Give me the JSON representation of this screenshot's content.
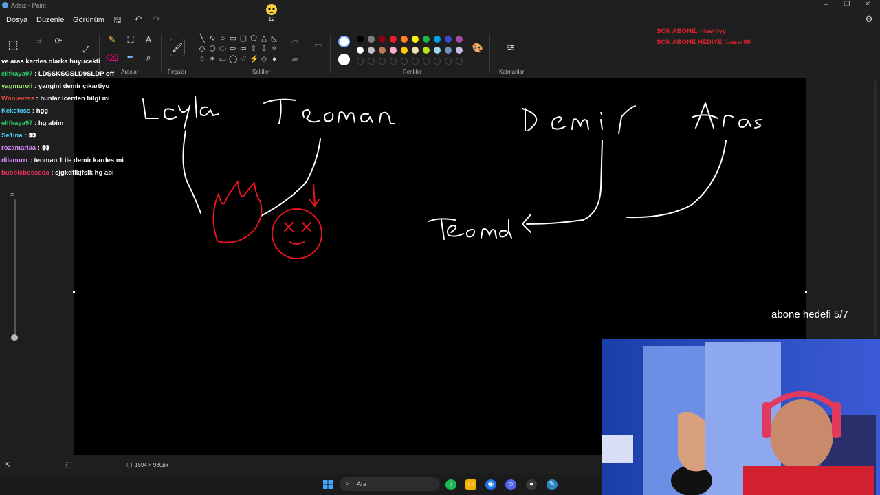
{
  "window": {
    "title": "Adsız - Paint"
  },
  "menu": {
    "file": "Dosya",
    "edit": "Düzenle",
    "view": "Görünüm"
  },
  "ribbon": {
    "tools_label": "Araçlar",
    "brushes_label": "Fırçalar",
    "shapes_label": "Şekiller",
    "colors_label": "Renkler",
    "layers_label": "Katmanlar",
    "palette_row1": [
      "#000000",
      "#7f7f7f",
      "#880015",
      "#ed1c24",
      "#ff7f27",
      "#fff200",
      "#22b14c",
      "#00a2e8",
      "#3f48cc",
      "#a349a4"
    ],
    "palette_row2": [
      "#ffffff",
      "#c3c3c3",
      "#b97a57",
      "#ffaec9",
      "#ffc90e",
      "#efe4b0",
      "#b5e61d",
      "#99d9ea",
      "#7092be",
      "#c8bfe7"
    ]
  },
  "drawing": {
    "white_words": [
      "Leyla",
      "Teoman",
      "Demir",
      "Aras",
      "Teoma"
    ]
  },
  "chat": [
    {
      "user": "",
      "text": "ve aras kardes olarka buyucekti",
      "color": "#ffffff"
    },
    {
      "user": "elifkaya97",
      "text": ": LDŞSKSGSLD9SLDP off",
      "color": "#2ecc71"
    },
    {
      "user": "yagmuroii",
      "text": ": yangini demir çıkartiyo",
      "color": "#9fe870"
    },
    {
      "user": "Wonievrss",
      "text": ": bunlar icerden bilgi mi",
      "color": "#e74c3c"
    },
    {
      "user": "Kekefoss",
      "text": ": hgg",
      "color": "#4fd1ff"
    },
    {
      "user": "elifkaya97",
      "text": ": hg abim",
      "color": "#2ecc71"
    },
    {
      "user": "Se1ina",
      "text": ": 👀",
      "color": "#4fd1ff"
    },
    {
      "user": "rozamariaa",
      "text": ": 👀",
      "color": "#d98cff"
    },
    {
      "user": "dilanurrr",
      "text": ": teoman 1 ile demir kardes mi",
      "color": "#d98cff"
    },
    {
      "user": "bubblebosseda",
      "text": ": sjgkdflkjfslk hg abi",
      "color": "#e6345a"
    }
  ],
  "overlay": {
    "last_sub": "SON ABONE: nisehlyy",
    "last_gift": "SON ABONE HEDİYE: basar00",
    "goal": "abone hedefi 5/7"
  },
  "status": {
    "canvas_size": "1594 × 930px"
  },
  "taskbar": {
    "search_placeholder": "Ara"
  }
}
